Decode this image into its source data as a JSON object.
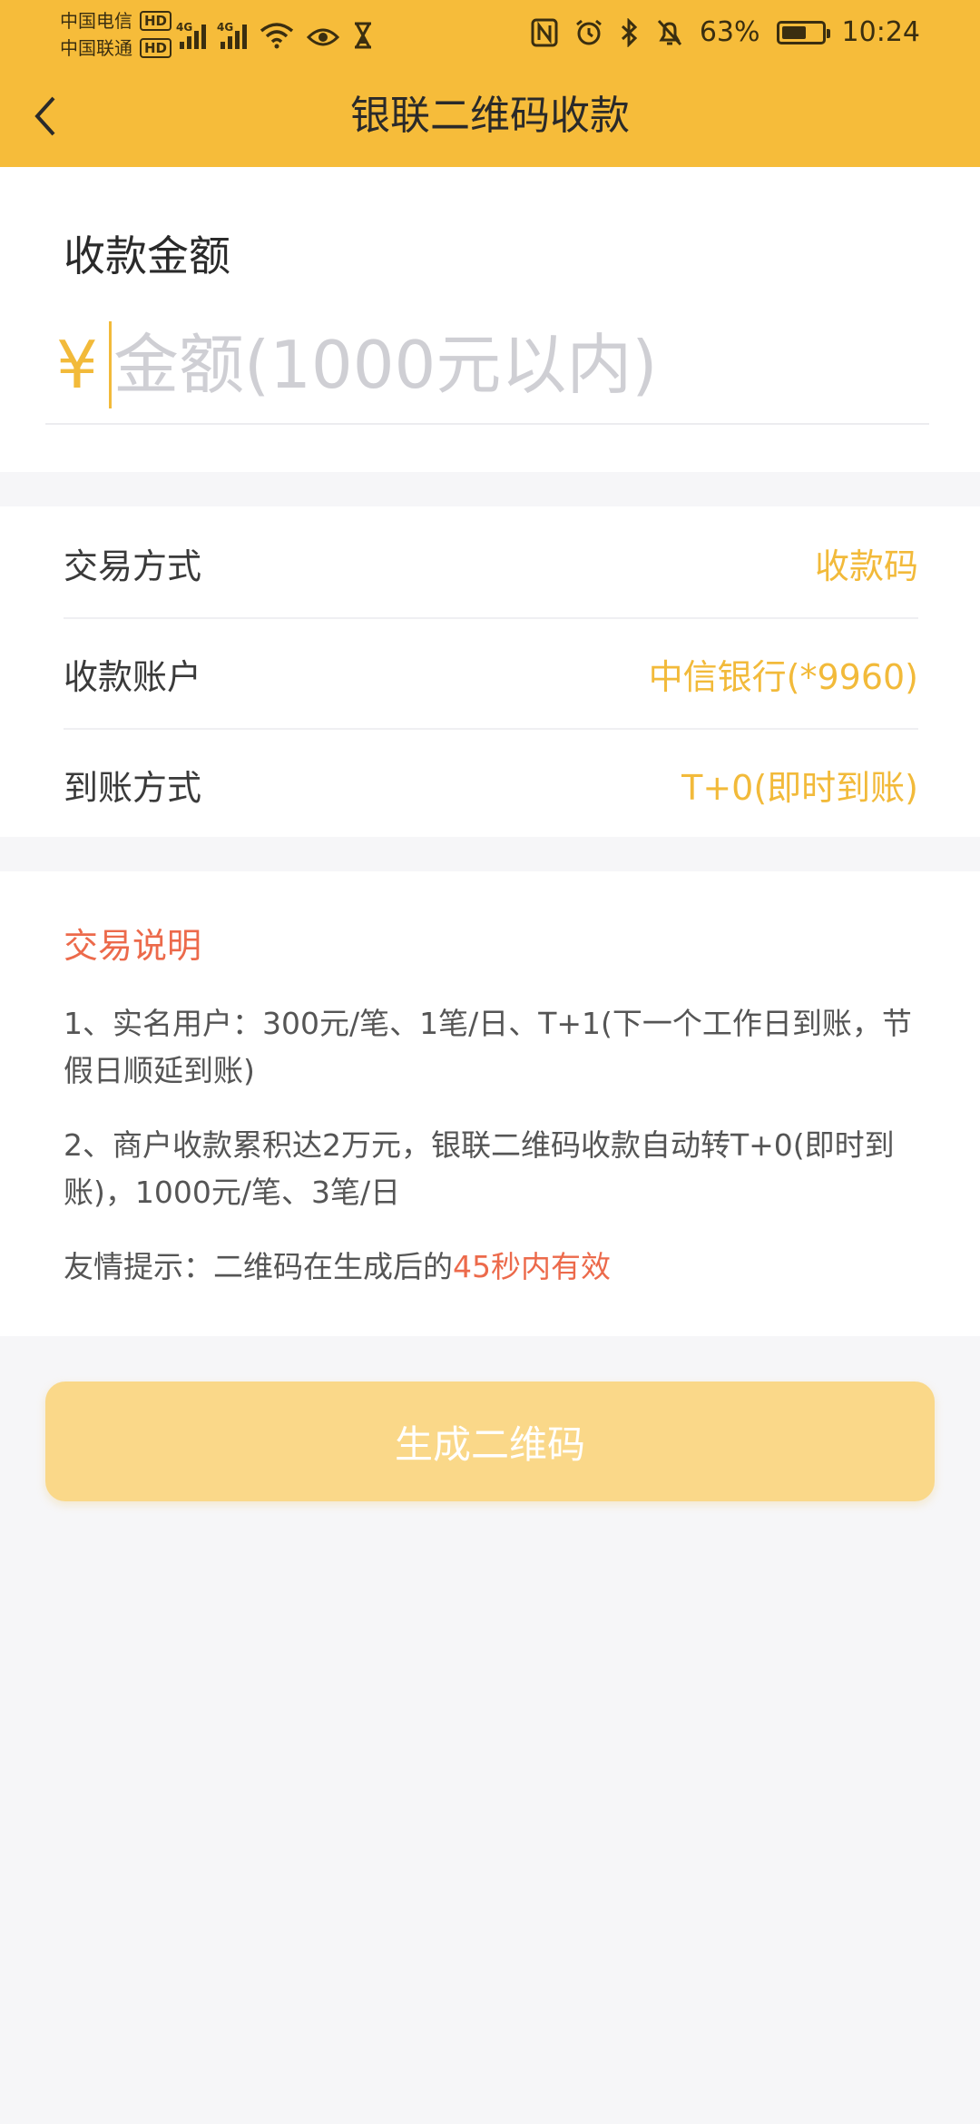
{
  "status_bar": {
    "carrier_1": "中国电信",
    "carrier_2": "中国联通",
    "hd_badge": "HD",
    "network_1": "4G",
    "network_2": "4G",
    "battery_percent": "63%",
    "battery_level": 0.63,
    "time": "10:24",
    "icons": [
      "wifi-icon",
      "eye-icon",
      "hourglass-icon",
      "nfc-icon",
      "alarm-icon",
      "bluetooth-icon",
      "bell-off-icon"
    ]
  },
  "nav": {
    "title": "银联二维码收款",
    "back_icon": "chevron-left-icon"
  },
  "amount": {
    "label": "收款金额",
    "currency_symbol": "¥",
    "placeholder": "金额(1000元以内)",
    "value": ""
  },
  "options": [
    {
      "label": "交易方式",
      "value": "收款码"
    },
    {
      "label": "收款账户",
      "value": "中信银行(*9960)"
    },
    {
      "label": "到账方式",
      "value": "T+0(即时到账)"
    }
  ],
  "info": {
    "title": "交易说明",
    "item_1": "1、实名用户：300元/笔、1笔/日、T+1(下一个工作日到账，节假日顺延到账)",
    "item_2": "2、商户收款累积达2万元，银联二维码收款自动转T+0(即时到账)，1000元/笔、3笔/日",
    "tip_prefix": "友情提示：二维码在生成后的",
    "tip_highlight": "45秒内有效"
  },
  "button": {
    "label": "生成二维码"
  },
  "colors": {
    "header": "#f6bc3a",
    "accent": "#f2ba3a",
    "highlight": "#ec6a4b",
    "button_disabled": "#fad889"
  }
}
